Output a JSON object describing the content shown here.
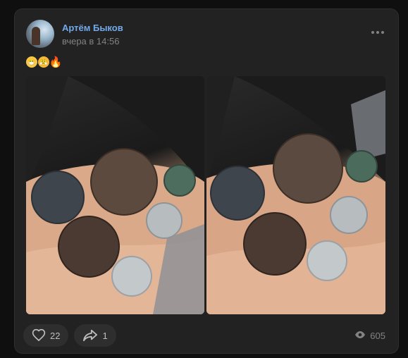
{
  "post": {
    "author": "Артём Быков",
    "time": "вчера в 14:56",
    "emoji": [
      "😷",
      "😤",
      "🔥"
    ],
    "likes": "22",
    "shares": "1",
    "views": "605"
  },
  "icons": {
    "more": "more-icon",
    "like": "heart-icon",
    "share": "share-icon",
    "views": "eye-icon"
  },
  "colors": {
    "background": "#0f0f0f",
    "card": "#222222",
    "author": "#71aaeb",
    "muted": "#828282",
    "pill": "#2e2e2e"
  }
}
